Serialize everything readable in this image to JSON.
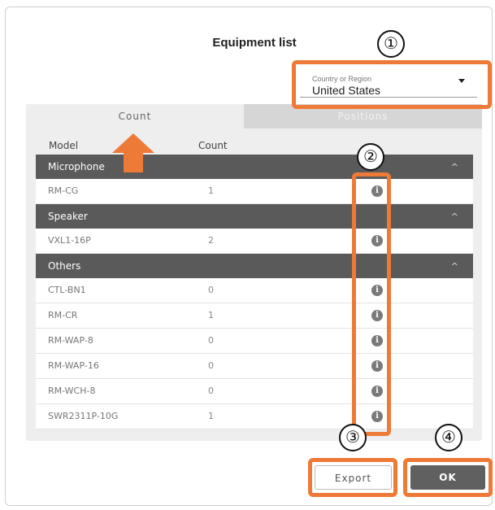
{
  "dialog": {
    "title": "Equipment list",
    "region": {
      "label": "Country or Region",
      "value": "United States"
    },
    "tabs": [
      {
        "label": "Count",
        "active": true
      },
      {
        "label": "Positions",
        "active": false
      }
    ],
    "columns": {
      "model": "Model",
      "count": "Count"
    },
    "groups": [
      {
        "name": "Microphone",
        "rows": [
          {
            "model": "RM-CG",
            "count": "1"
          }
        ]
      },
      {
        "name": "Speaker",
        "rows": [
          {
            "model": "VXL1-16P",
            "count": "2"
          }
        ]
      },
      {
        "name": "Others",
        "rows": [
          {
            "model": "CTL-BN1",
            "count": "0"
          },
          {
            "model": "RM-CR",
            "count": "1"
          },
          {
            "model": "RM-WAP-8",
            "count": "0"
          },
          {
            "model": "RM-WAP-16",
            "count": "0"
          },
          {
            "model": "RM-WCH-8",
            "count": "0"
          },
          {
            "model": "SWR2311P-10G",
            "count": "1"
          }
        ]
      }
    ],
    "buttons": {
      "export": "Export",
      "ok": "OK"
    }
  },
  "callouts": [
    "①",
    "②",
    "③",
    "④"
  ],
  "colors": {
    "callout": "#ee7a37",
    "header": "#5a5a5a"
  }
}
